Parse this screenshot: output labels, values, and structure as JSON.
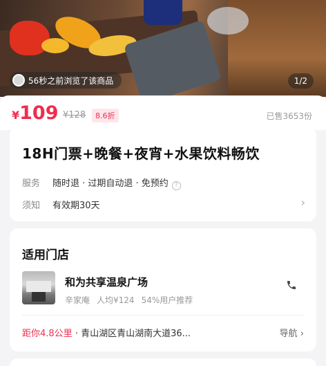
{
  "hero": {
    "browse_text": "56秒之前浏览了该商品",
    "pager": "1/2"
  },
  "price": {
    "currency": "¥",
    "current": "109",
    "original": "¥128",
    "discount": "8.6折",
    "sold": "已售3653份"
  },
  "deal": {
    "title": "18H门票+晚餐+夜宵+水果饮料畅饮",
    "service_label": "服务",
    "service_value": "随时退 · 过期自动退 · 免预约",
    "notice_label": "须知",
    "notice_value": "有效期30天"
  },
  "store": {
    "heading": "适用门店",
    "name": "和为共享温泉广场",
    "area": "辛家庵",
    "per_person": "人均¥124",
    "recommend": "54%用户推荐",
    "distance": "距你4.8公里",
    "address": " · 青山湖区青山湖南大道36...",
    "nav_label": "导航"
  },
  "colors": {
    "accent": "#ef2d4f",
    "background": "#f4f4f6"
  },
  "icons": {
    "info": "info-circle-icon",
    "chevron": "chevron-right-icon",
    "phone": "phone-icon"
  }
}
